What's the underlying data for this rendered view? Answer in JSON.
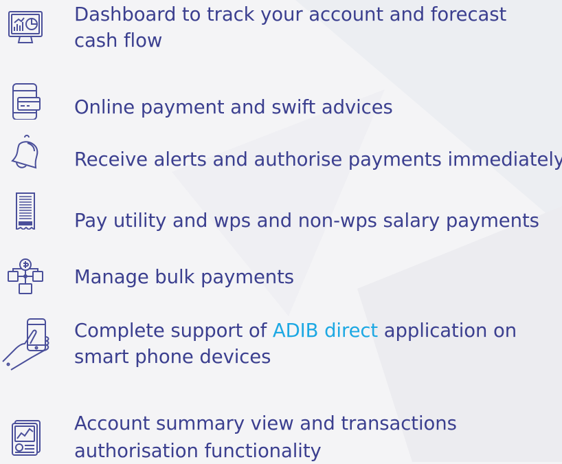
{
  "features": [
    {
      "icon": "dashboard-monitor-icon",
      "lines": [
        "Dashboard to track your account and forecast",
        "cash flow"
      ]
    },
    {
      "icon": "phone-card-icon",
      "lines": [
        "Online payment and swift advices"
      ]
    },
    {
      "icon": "bell-alert-icon",
      "lines": [
        "Receive alerts and authorise payments immediately"
      ]
    },
    {
      "icon": "receipt-icon",
      "lines": [
        "Pay utility and wps and non-wps salary payments"
      ]
    },
    {
      "icon": "bulk-payments-network-icon",
      "lines": [
        "Manage bulk payments"
      ]
    },
    {
      "icon": "hand-phone-icon",
      "line1_before": "Complete support of ",
      "line1_link": "ADIB direct",
      "line1_after": " application on",
      "line2": "smart phone devices"
    },
    {
      "icon": "documents-chart-icon",
      "lines": [
        "Account summary view and transactions",
        "authorisation functionality"
      ]
    }
  ],
  "colors": {
    "text": "#3b3f8f",
    "link": "#1da8e3",
    "icon": "#4a4f9a",
    "background": "#f4f4f6"
  }
}
